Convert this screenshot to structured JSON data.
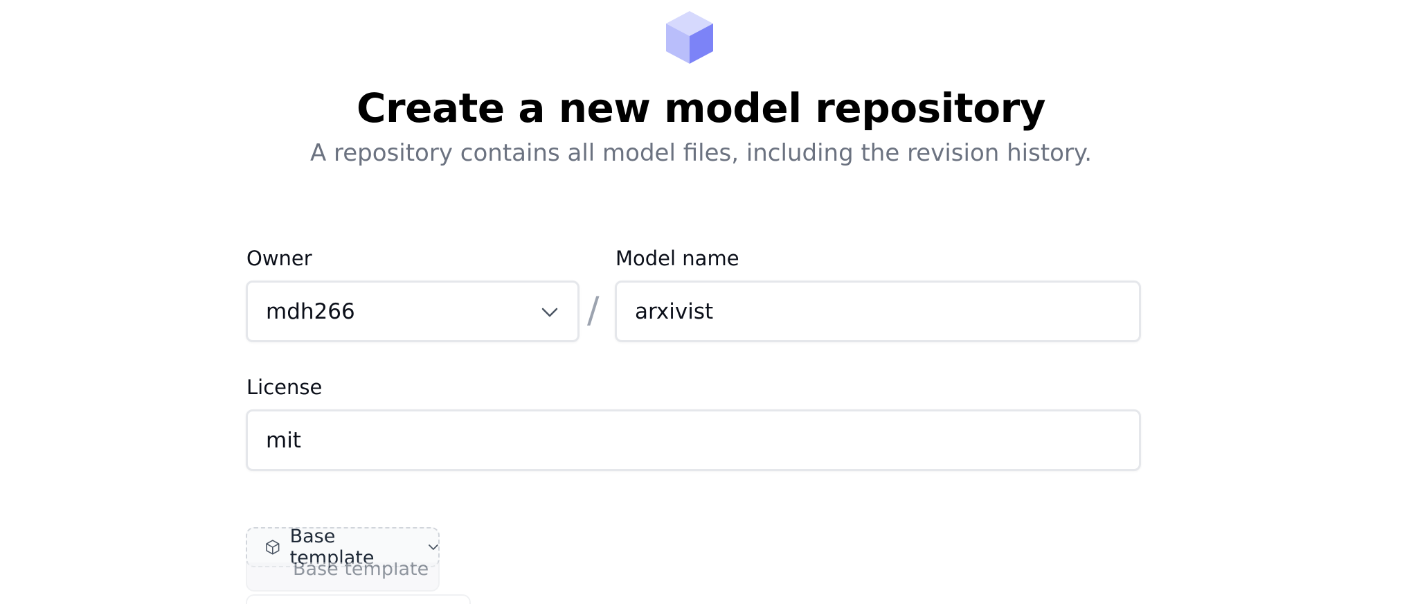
{
  "header": {
    "logo_icon": "cube-icon",
    "title": "Create a new model repository",
    "subtitle": "A repository contains all model files, including the revision history."
  },
  "form": {
    "owner": {
      "label": "Owner",
      "value": "mdh266",
      "icon": "chevron-down-icon"
    },
    "separator": "/",
    "model_name": {
      "label": "Model name",
      "value": "arxivist"
    },
    "license": {
      "label": "License",
      "value": "mit"
    },
    "template": {
      "label": "Base template",
      "icon": "cube-outline-icon",
      "chevron_icon": "chevron-down-icon",
      "ghost_label": "Base template"
    }
  },
  "colors": {
    "logo_light": "#c7cbfb",
    "logo_dark": "#7c83f7",
    "subtitle": "#6b7280",
    "border": "#e5e7eb"
  }
}
